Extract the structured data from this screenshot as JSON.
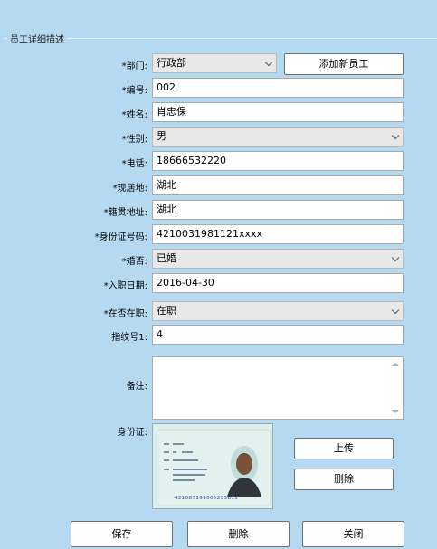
{
  "group": {
    "title": "员工详细描述"
  },
  "form": {
    "department": {
      "label": "*部门:",
      "value": "行政部"
    },
    "add_button": "添加新员工",
    "number": {
      "label": "*编号:",
      "value": "002"
    },
    "name": {
      "label": "*姓名:",
      "value": "肖忠保"
    },
    "gender": {
      "label": "*性别:",
      "value": "男"
    },
    "phone": {
      "label": "*电话:",
      "value": "18666532220"
    },
    "residence": {
      "label": "*现居地:",
      "value": "湖北"
    },
    "native_place": {
      "label": "*籍贯地址:",
      "value": "湖北"
    },
    "id_number": {
      "label": "*身份证号码:",
      "value": "4210031981121xxxx"
    },
    "married": {
      "label": "*婚否:",
      "value": "已婚"
    },
    "hire_date": {
      "label": "*入职日期:",
      "value": "2016-04-30"
    },
    "employed": {
      "label": "*在否在职:",
      "value": "在职"
    },
    "fingerprint": {
      "label": "指纹号1:",
      "value": "4"
    },
    "remarks": {
      "label": "备注:",
      "value": ""
    },
    "id_card": {
      "label": "身份证:"
    }
  },
  "id_card_photo": {
    "id_number_text": "421087199005235815",
    "accent": "#2b4f8f",
    "face_color": "#7a5038"
  },
  "photo_buttons": {
    "upload": "上传",
    "delete": "删除"
  },
  "footer": {
    "save": "保存",
    "delete": "删除",
    "close": "关闭"
  }
}
